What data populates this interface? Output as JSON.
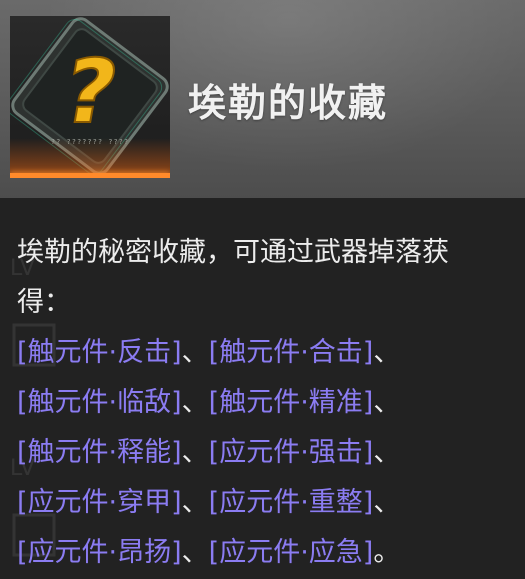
{
  "item": {
    "name": "埃勒的收藏",
    "icon": "question-mark-crate-icon",
    "icon_subtext": "?? ??????? ????",
    "rarity_color": "#ff8a2a"
  },
  "description": {
    "intro_line1": "埃勒的秘密收藏，可通过武器掉落获",
    "intro_line2": "得："
  },
  "drops": [
    "[触元件·反击]",
    "[触元件·合击]",
    "[触元件·临敌]",
    "[触元件·精准]",
    "[触元件·释能]",
    "[应元件·强击]",
    "[应元件·穿甲]",
    "[应元件·重整]",
    "[应元件·昂扬]",
    "[应元件·应急]"
  ],
  "separators": {
    "comma": "、",
    "period": "。"
  },
  "colors": {
    "link": "#8b7cf2",
    "text": "#ececec",
    "header_bg": "#5b5b5b",
    "body_bg": "#222222",
    "accent": "#ffc21a"
  }
}
